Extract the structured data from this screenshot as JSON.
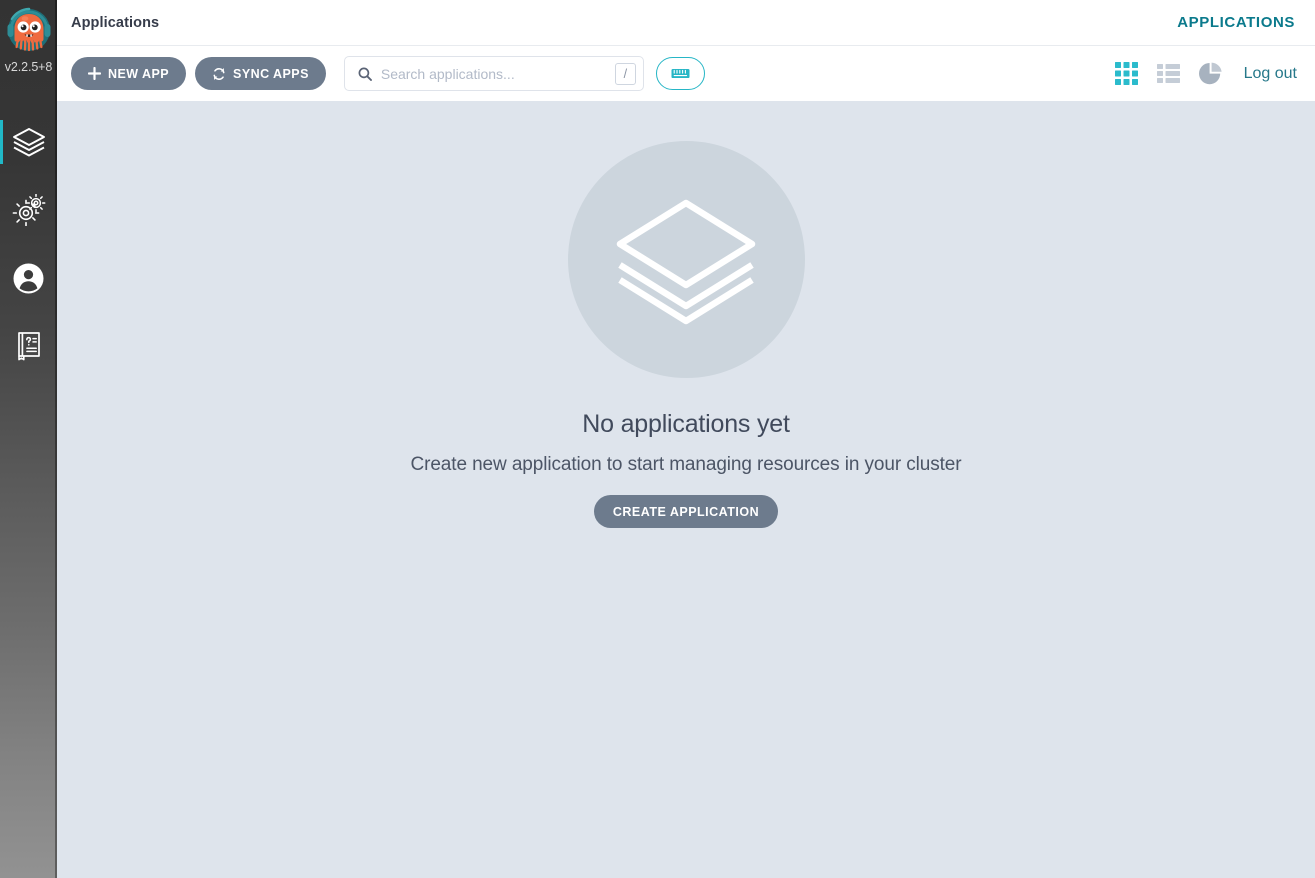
{
  "sidebar": {
    "logo_icon": "argo-octopus-logo",
    "version": "v2.2.5+8",
    "items": [
      {
        "label": "Applications",
        "icon": "layers-icon",
        "name": "sidebar-item-applications",
        "active": true
      },
      {
        "label": "Settings",
        "icon": "gears-icon",
        "name": "sidebar-item-settings",
        "active": false
      },
      {
        "label": "User Info",
        "icon": "user-icon",
        "name": "sidebar-item-user-info",
        "active": false
      },
      {
        "label": "Documentation",
        "icon": "book-icon",
        "name": "sidebar-item-documentation",
        "active": false
      }
    ]
  },
  "header": {
    "breadcrumb": "Applications",
    "title": "APPLICATIONS"
  },
  "toolbar": {
    "new_app_label": "NEW APP",
    "new_app_icon": "plus-icon",
    "sync_apps_label": "SYNC APPS",
    "sync_apps_icon": "sync-icon",
    "search": {
      "placeholder": "Search applications...",
      "value": "",
      "icon": "search-icon",
      "shortcut_badge": "/"
    },
    "keyboard_shortcuts_icon": "keyboard-icon",
    "views": [
      {
        "name": "tiles-view-toggle",
        "icon": "grid-icon",
        "active": true
      },
      {
        "name": "list-view-toggle",
        "icon": "list-icon",
        "active": false
      },
      {
        "name": "summary-view-toggle",
        "icon": "pie-chart-icon",
        "active": false
      }
    ],
    "logout_label": "Log out"
  },
  "empty_state": {
    "icon": "layers-stack-icon",
    "title": "No applications yet",
    "subtitle": "Create new application to start managing resources in your cluster",
    "button_label": "CREATE APPLICATION"
  },
  "colors": {
    "accent_teal": "#27b6c6",
    "header_title_teal": "#0b7a8c",
    "logout_teal": "#26788a",
    "button_slate": "#6d7b8d",
    "content_bg": "#dee4ec",
    "empty_circle": "#ccd5dd",
    "sidebar_dark": "#333333",
    "sidebar_light": "#929292"
  }
}
